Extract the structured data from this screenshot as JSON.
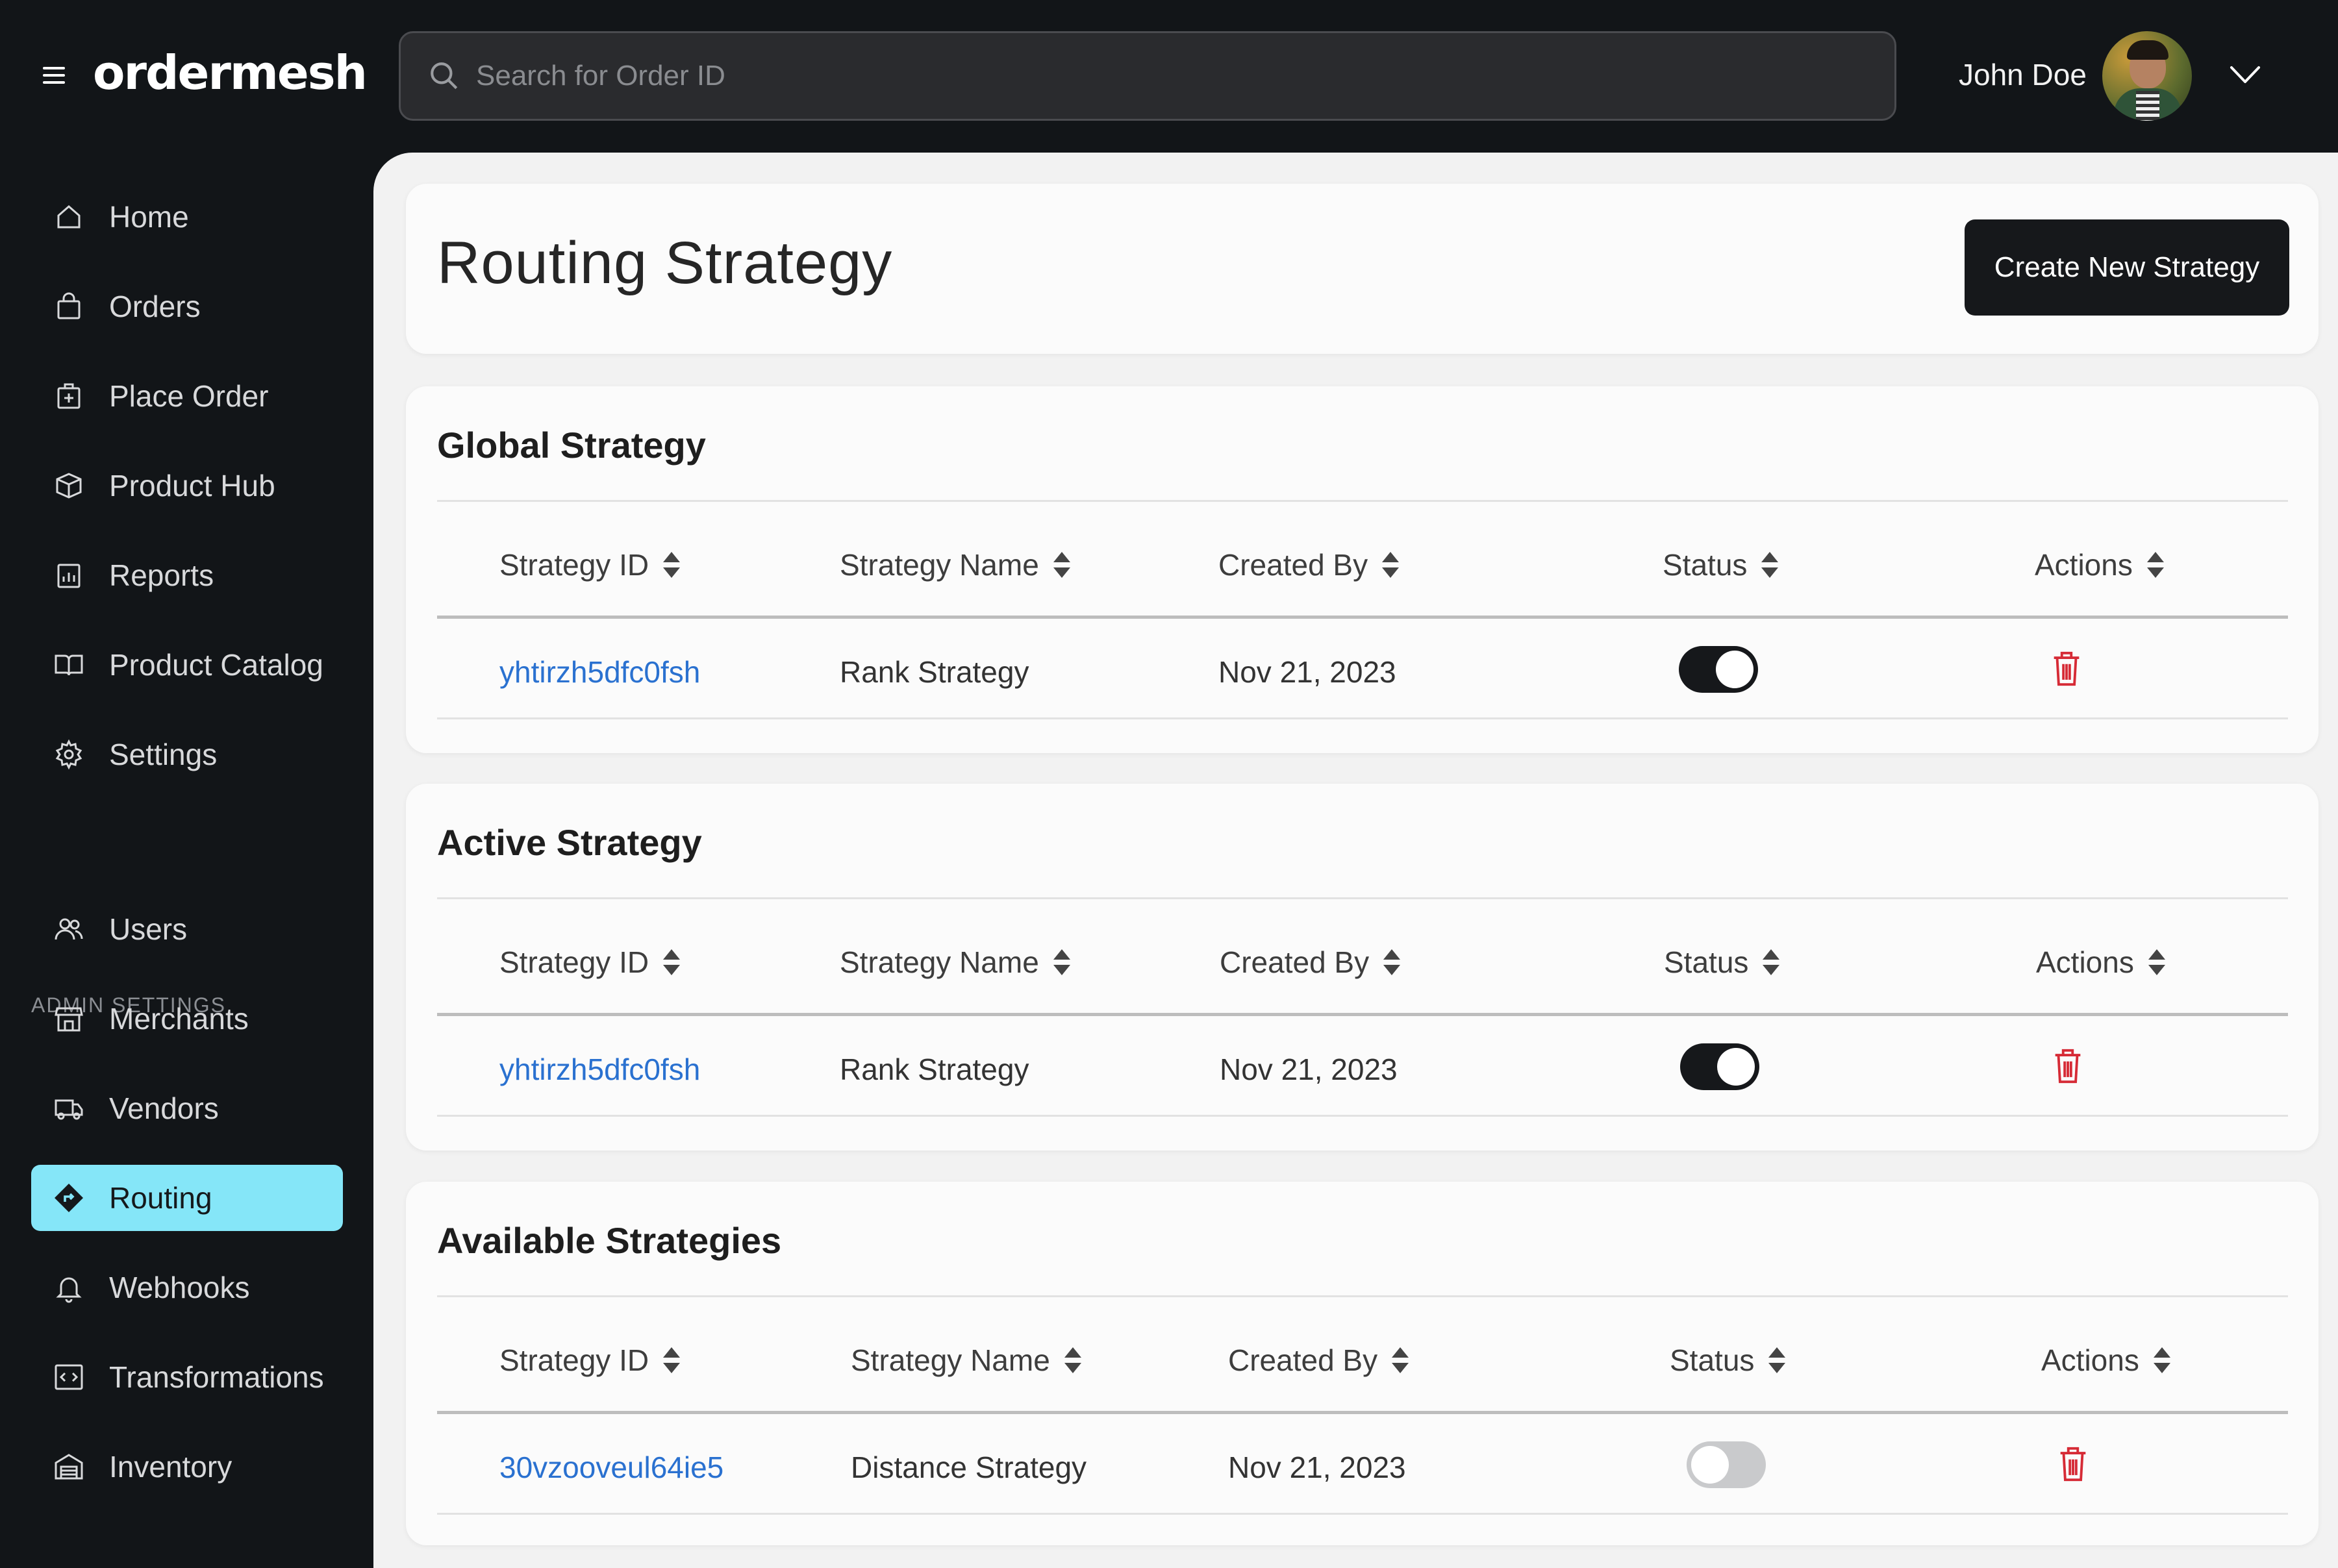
{
  "app": {
    "logo": "ordermesh"
  },
  "search": {
    "placeholder": "Search for Order ID"
  },
  "user": {
    "name": "John Doe"
  },
  "sidebar": {
    "items": [
      {
        "label": "Home",
        "icon": "home-icon"
      },
      {
        "label": "Orders",
        "icon": "shopping-bag-icon"
      },
      {
        "label": "Place Order",
        "icon": "place-order-icon"
      },
      {
        "label": "Product Hub",
        "icon": "box-icon"
      },
      {
        "label": "Reports",
        "icon": "reports-icon"
      },
      {
        "label": "Product Catalog",
        "icon": "book-icon"
      },
      {
        "label": "Settings",
        "icon": "gear-icon"
      }
    ],
    "admin_label": "ADMIN SETTINGS",
    "admin_items": [
      {
        "label": "Users",
        "icon": "users-icon"
      },
      {
        "label": "Merchants",
        "icon": "storefront-icon"
      },
      {
        "label": "Vendors",
        "icon": "truck-icon"
      },
      {
        "label": "Routing",
        "icon": "routing-icon",
        "active": true
      },
      {
        "label": "Webhooks",
        "icon": "bell-icon"
      },
      {
        "label": "Transformations",
        "icon": "code-icon"
      },
      {
        "label": "Inventory",
        "icon": "warehouse-icon"
      }
    ]
  },
  "page": {
    "title": "Routing Strategy",
    "create_button": "Create New Strategy"
  },
  "table_headers": {
    "strategy_id": "Strategy ID",
    "strategy_name": "Strategy Name",
    "created_by": "Created By",
    "status": "Status",
    "actions": "Actions"
  },
  "sections": [
    {
      "title": "Global Strategy",
      "rows": [
        {
          "strategy_id": "yhtirzh5dfc0fsh",
          "strategy_name": "Rank Strategy",
          "created_by": "Nov 21, 2023",
          "status": "on"
        }
      ]
    },
    {
      "title": "Active Strategy",
      "rows": [
        {
          "strategy_id": "yhtirzh5dfc0fsh",
          "strategy_name": "Rank Strategy",
          "created_by": "Nov 21, 2023",
          "status": "on"
        }
      ]
    },
    {
      "title": "Available Strategies",
      "rows": [
        {
          "strategy_id": "30vzooveul64ie5",
          "strategy_name": "Distance Strategy",
          "created_by": "Nov 21, 2023",
          "status": "off"
        }
      ]
    }
  ],
  "colors": {
    "background": "#121518",
    "accent_active": "#85e6f8",
    "link": "#2a71d0",
    "delete": "#d62b36",
    "toggle_on": "#16181b",
    "toggle_off": "#c9cacc"
  }
}
